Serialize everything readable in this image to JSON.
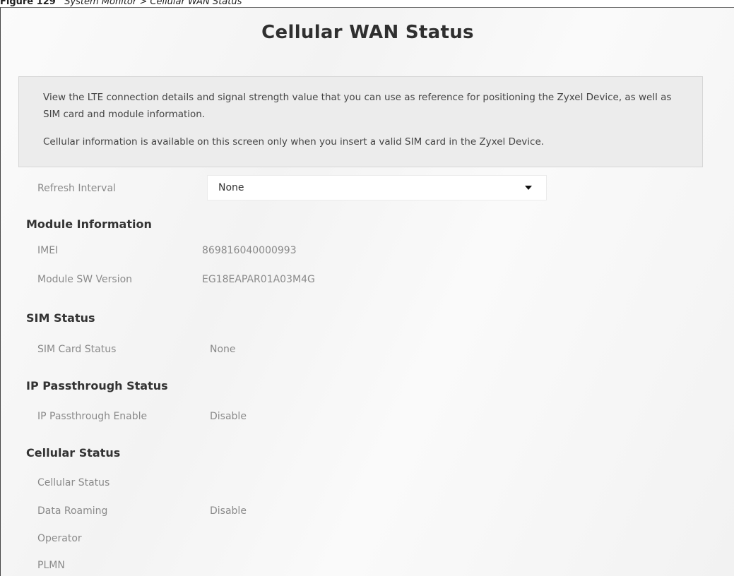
{
  "caption": {
    "figure_label": "Figure 129",
    "title": "System Monitor > Cellular WAN Status"
  },
  "page": {
    "title": "Cellular WAN Status"
  },
  "description": {
    "paragraph1": "View the LTE connection details and signal strength value that you can use as reference for positioning the Zyxel Device, as well as SIM card and module information.",
    "paragraph2": "Cellular information is available on this screen only when you insert a valid SIM card in the Zyxel Device."
  },
  "refresh": {
    "label": "Refresh Interval",
    "selected": "None"
  },
  "module_information": {
    "heading": "Module Information",
    "imei_label": "IMEI",
    "imei_value": "869816040000993",
    "sw_label": "Module SW Version",
    "sw_value": "EG18EAPAR01A03M4G"
  },
  "sim_status": {
    "heading": "SIM Status",
    "card_label": "SIM Card Status",
    "card_value": "None"
  },
  "ip_passthrough": {
    "heading": "IP Passthrough Status",
    "enable_label": "IP Passthrough Enable",
    "enable_value": "Disable"
  },
  "cellular_status": {
    "heading": "Cellular Status",
    "status_label": "Cellular Status",
    "status_value": "",
    "roaming_label": "Data Roaming",
    "roaming_value": "Disable",
    "operator_label": "Operator",
    "operator_value": "",
    "plmn_label": "PLMN",
    "plmn_value": ""
  }
}
